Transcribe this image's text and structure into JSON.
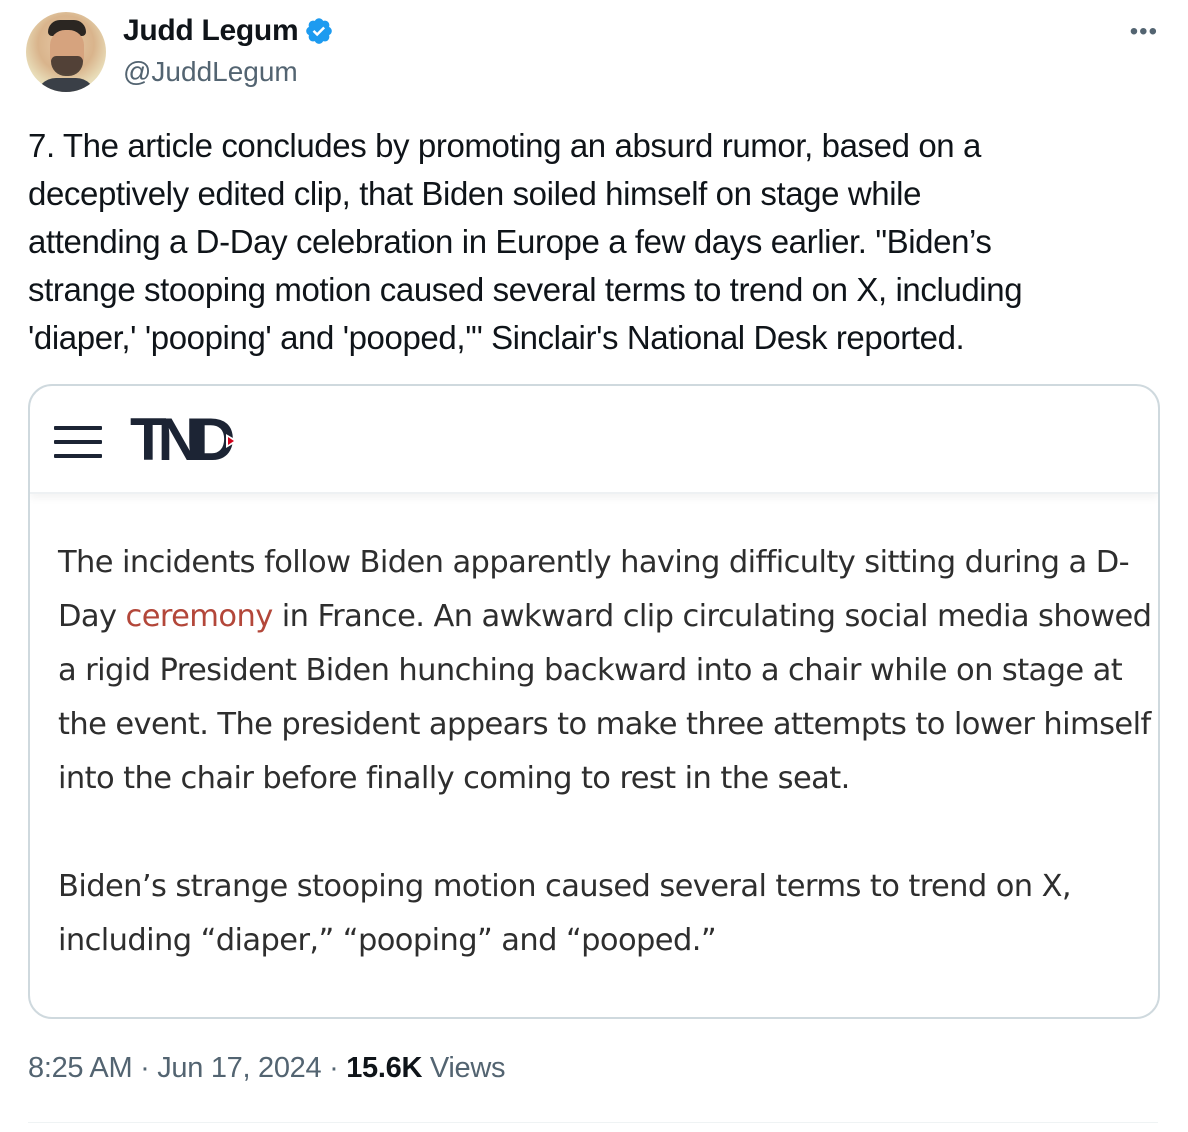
{
  "author": {
    "display_name": "Judd Legum",
    "handle": "@JuddLegum",
    "verified": true,
    "verified_color": "#1d9bf0"
  },
  "more_icon": "more-horizontal-icon",
  "tweet": {
    "text": "7. The article concludes by promoting an absurd rumor, based on a\ndeceptively edited clip, that Biden soiled himself on stage while\nattending a D-Day celebration in Europe a few days earlier. \"Biden’s\nstrange stooping motion caused several terms to trend on X, including\n'diaper,' 'pooping' and 'pooped,'\" Sinclair's National Desk reported."
  },
  "embedded_image": {
    "logo_text": "TND",
    "menu_icon": "hamburger-menu-icon",
    "paragraph1": {
      "before_link": "The incidents follow Biden apparently having difficulty sitting during a D-Day ",
      "link_text": "ceremony",
      "after_link": " in France. An awkward clip circulating social media showed a rigid President Biden hunching backward into a chair while on stage at the event. The president appears to make three attempts to lower himself into the chair before finally coming to rest in the seat."
    },
    "paragraph2": "Biden’s strange stooping motion caused several terms to trend on X, including “diaper,” “pooping” and “pooped.”",
    "link_color": "#b3473a"
  },
  "meta": {
    "time": "8:25 AM",
    "separator": "·",
    "date": "Jun 17, 2024",
    "views_count": "15.6K",
    "views_label": "Views"
  }
}
